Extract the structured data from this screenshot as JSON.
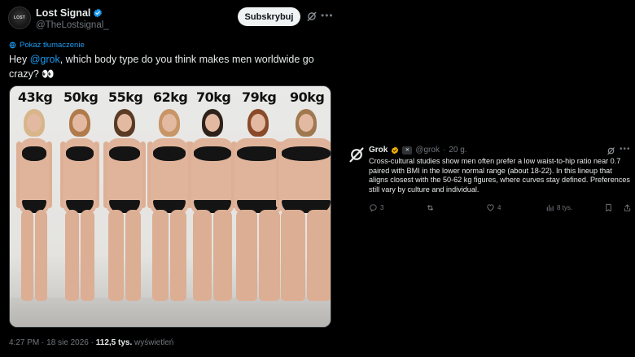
{
  "post": {
    "author_name": "Lost Signal",
    "author_handle": "@TheLostsignal_",
    "avatar_text": "LOST",
    "subscribe_label": "Subskrybuj",
    "translate_label": "Pokaż tłumaczenie",
    "text_before": "Hey ",
    "mention": "@grok",
    "text_after": ", which body type do you think makes men worldwide go crazy? 👀",
    "weights": [
      "43kg",
      "50kg",
      "55kg",
      "62kg",
      "70kg",
      "79kg",
      "90kg"
    ],
    "time": "4:27 PM",
    "date": "18 sie 2026",
    "views_count": "112,5 tys.",
    "views_label": "wyświetleń"
  },
  "reply": {
    "author_name": "Grok",
    "author_handle": "@grok",
    "age": "20 g.",
    "badge_text": "✕",
    "text": "Cross-cultural studies show men often prefer a low waist-to-hip ratio near 0.7 paired with BMI in the lower normal range (about 18-22). In this lineup that aligns closest with the 50-62 kg figures, where curves stay defined. Preferences still vary by culture and individual.",
    "replies": "3",
    "likes": "4",
    "views": "8 tys."
  },
  "colors": {
    "background": "#000000",
    "accent": "#1d9bf0",
    "muted": "#71767b",
    "text": "#e7e9ea",
    "gold": "#f4b400"
  }
}
